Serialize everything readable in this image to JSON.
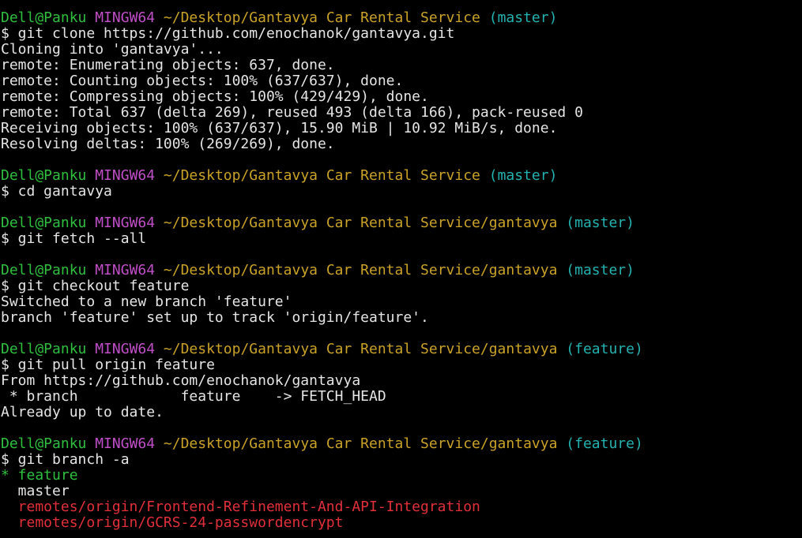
{
  "colors": {
    "background": "#000000",
    "foreground": "#e5e5e5",
    "user": "#2fbf3f",
    "host": "#c04fc7",
    "path": "#c9a227",
    "branch": "#23b3b0",
    "current_branch": "#2fbf3f",
    "remote_branch": "#e0303a"
  },
  "lines": [
    {
      "type": "prompt",
      "user": "Dell@Panku",
      "host": "MINGW64",
      "path": "~/Desktop/Gantavya Car Rental Service",
      "branch": "(master)"
    },
    {
      "type": "cmd",
      "text": "$ git clone https://github.com/enochanok/gantavya.git"
    },
    {
      "type": "out",
      "text": "Cloning into 'gantavya'..."
    },
    {
      "type": "out",
      "text": "remote: Enumerating objects: 637, done."
    },
    {
      "type": "out",
      "text": "remote: Counting objects: 100% (637/637), done."
    },
    {
      "type": "out",
      "text": "remote: Compressing objects: 100% (429/429), done."
    },
    {
      "type": "out",
      "text": "remote: Total 637 (delta 269), reused 493 (delta 166), pack-reused 0"
    },
    {
      "type": "out",
      "text": "Receiving objects: 100% (637/637), 15.90 MiB | 10.92 MiB/s, done."
    },
    {
      "type": "out",
      "text": "Resolving deltas: 100% (269/269), done."
    },
    {
      "type": "blank",
      "text": ""
    },
    {
      "type": "prompt",
      "user": "Dell@Panku",
      "host": "MINGW64",
      "path": "~/Desktop/Gantavya Car Rental Service",
      "branch": "(master)"
    },
    {
      "type": "cmd",
      "text": "$ cd gantavya"
    },
    {
      "type": "blank",
      "text": ""
    },
    {
      "type": "prompt",
      "user": "Dell@Panku",
      "host": "MINGW64",
      "path": "~/Desktop/Gantavya Car Rental Service/gantavya",
      "branch": "(master)"
    },
    {
      "type": "cmd",
      "text": "$ git fetch --all"
    },
    {
      "type": "blank",
      "text": ""
    },
    {
      "type": "prompt",
      "user": "Dell@Panku",
      "host": "MINGW64",
      "path": "~/Desktop/Gantavya Car Rental Service/gantavya",
      "branch": "(master)"
    },
    {
      "type": "cmd",
      "text": "$ git checkout feature"
    },
    {
      "type": "out",
      "text": "Switched to a new branch 'feature'"
    },
    {
      "type": "out",
      "text": "branch 'feature' set up to track 'origin/feature'."
    },
    {
      "type": "blank",
      "text": ""
    },
    {
      "type": "prompt",
      "user": "Dell@Panku",
      "host": "MINGW64",
      "path": "~/Desktop/Gantavya Car Rental Service/gantavya",
      "branch": "(feature)"
    },
    {
      "type": "cmd",
      "text": "$ git pull origin feature"
    },
    {
      "type": "out",
      "text": "From https://github.com/enochanok/gantavya"
    },
    {
      "type": "out",
      "text": " * branch            feature    -> FETCH_HEAD"
    },
    {
      "type": "out",
      "text": "Already up to date."
    },
    {
      "type": "blank",
      "text": ""
    },
    {
      "type": "prompt",
      "user": "Dell@Panku",
      "host": "MINGW64",
      "path": "~/Desktop/Gantavya Car Rental Service/gantavya",
      "branch": "(feature)"
    },
    {
      "type": "cmd",
      "text": "$ git branch -a"
    },
    {
      "type": "current",
      "text": "* feature"
    },
    {
      "type": "out",
      "text": "  master"
    },
    {
      "type": "remote",
      "text": "  remotes/origin/Frontend-Refinement-And-API-Integration"
    },
    {
      "type": "remote",
      "text": "  remotes/origin/GCRS-24-passwordencrypt"
    }
  ]
}
